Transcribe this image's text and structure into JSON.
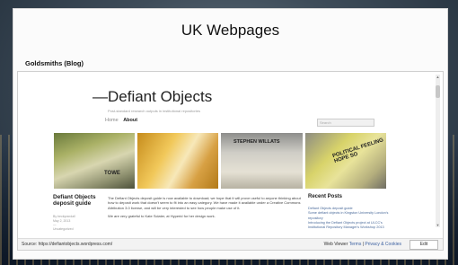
{
  "slide": {
    "title": "UK Webpages",
    "subtitle": "Goldsmiths (Blog)"
  },
  "blog": {
    "title": "—Defiant Objects",
    "tagline": "Post-standard research outputs in institutional repositories",
    "nav": {
      "home": "Home",
      "about": "About"
    },
    "search_placeholder": "Search",
    "photos": [
      {
        "icon": "photo-towel",
        "text": "TOWE"
      },
      {
        "icon": "photo-yellow-abstract",
        "text": ""
      },
      {
        "icon": "photo-stephen-willats",
        "text": "STEPHEN WILLATS"
      },
      {
        "icon": "photo-political-feeling",
        "text": "POLITICAL FEELING HOPE SO"
      }
    ],
    "post": {
      "title": "Defiant Objects deposit guide",
      "author": "By beckyrandall",
      "date": "May 2, 2013",
      "comment": "—",
      "category": "Uncategorized",
      "paragraph1": "The Defiant Objects deposit guide is now available to download; we hope that it will prove useful to anyone thinking about how to deposit work that doesn't seem to fit into an easy category. We have made it available under a Creative Commons Attribution 3.0 license, and will be very interested to see how people make use of it.",
      "paragraph2": "We are very grateful to Kate Sclater, at Hyperid for her design work."
    },
    "recent": {
      "title": "Recent Posts",
      "items": [
        "Defiant Objects deposit guide",
        "Some defiant objects in Kingston University London's repository",
        "Introducing the Defiant Objects project at ULCC's Institutional Repository Manager's Workshop 2013"
      ]
    }
  },
  "viewer": {
    "source": "Source: https://defiantobjects.wordpress.com/",
    "label": "Web Viewer",
    "terms": "Terms",
    "sep": "|",
    "privacy": "Privacy & Cookies",
    "edit": "Edit"
  },
  "colors": {
    "link": "#3a5fa0",
    "background": "#fbfbfb"
  }
}
